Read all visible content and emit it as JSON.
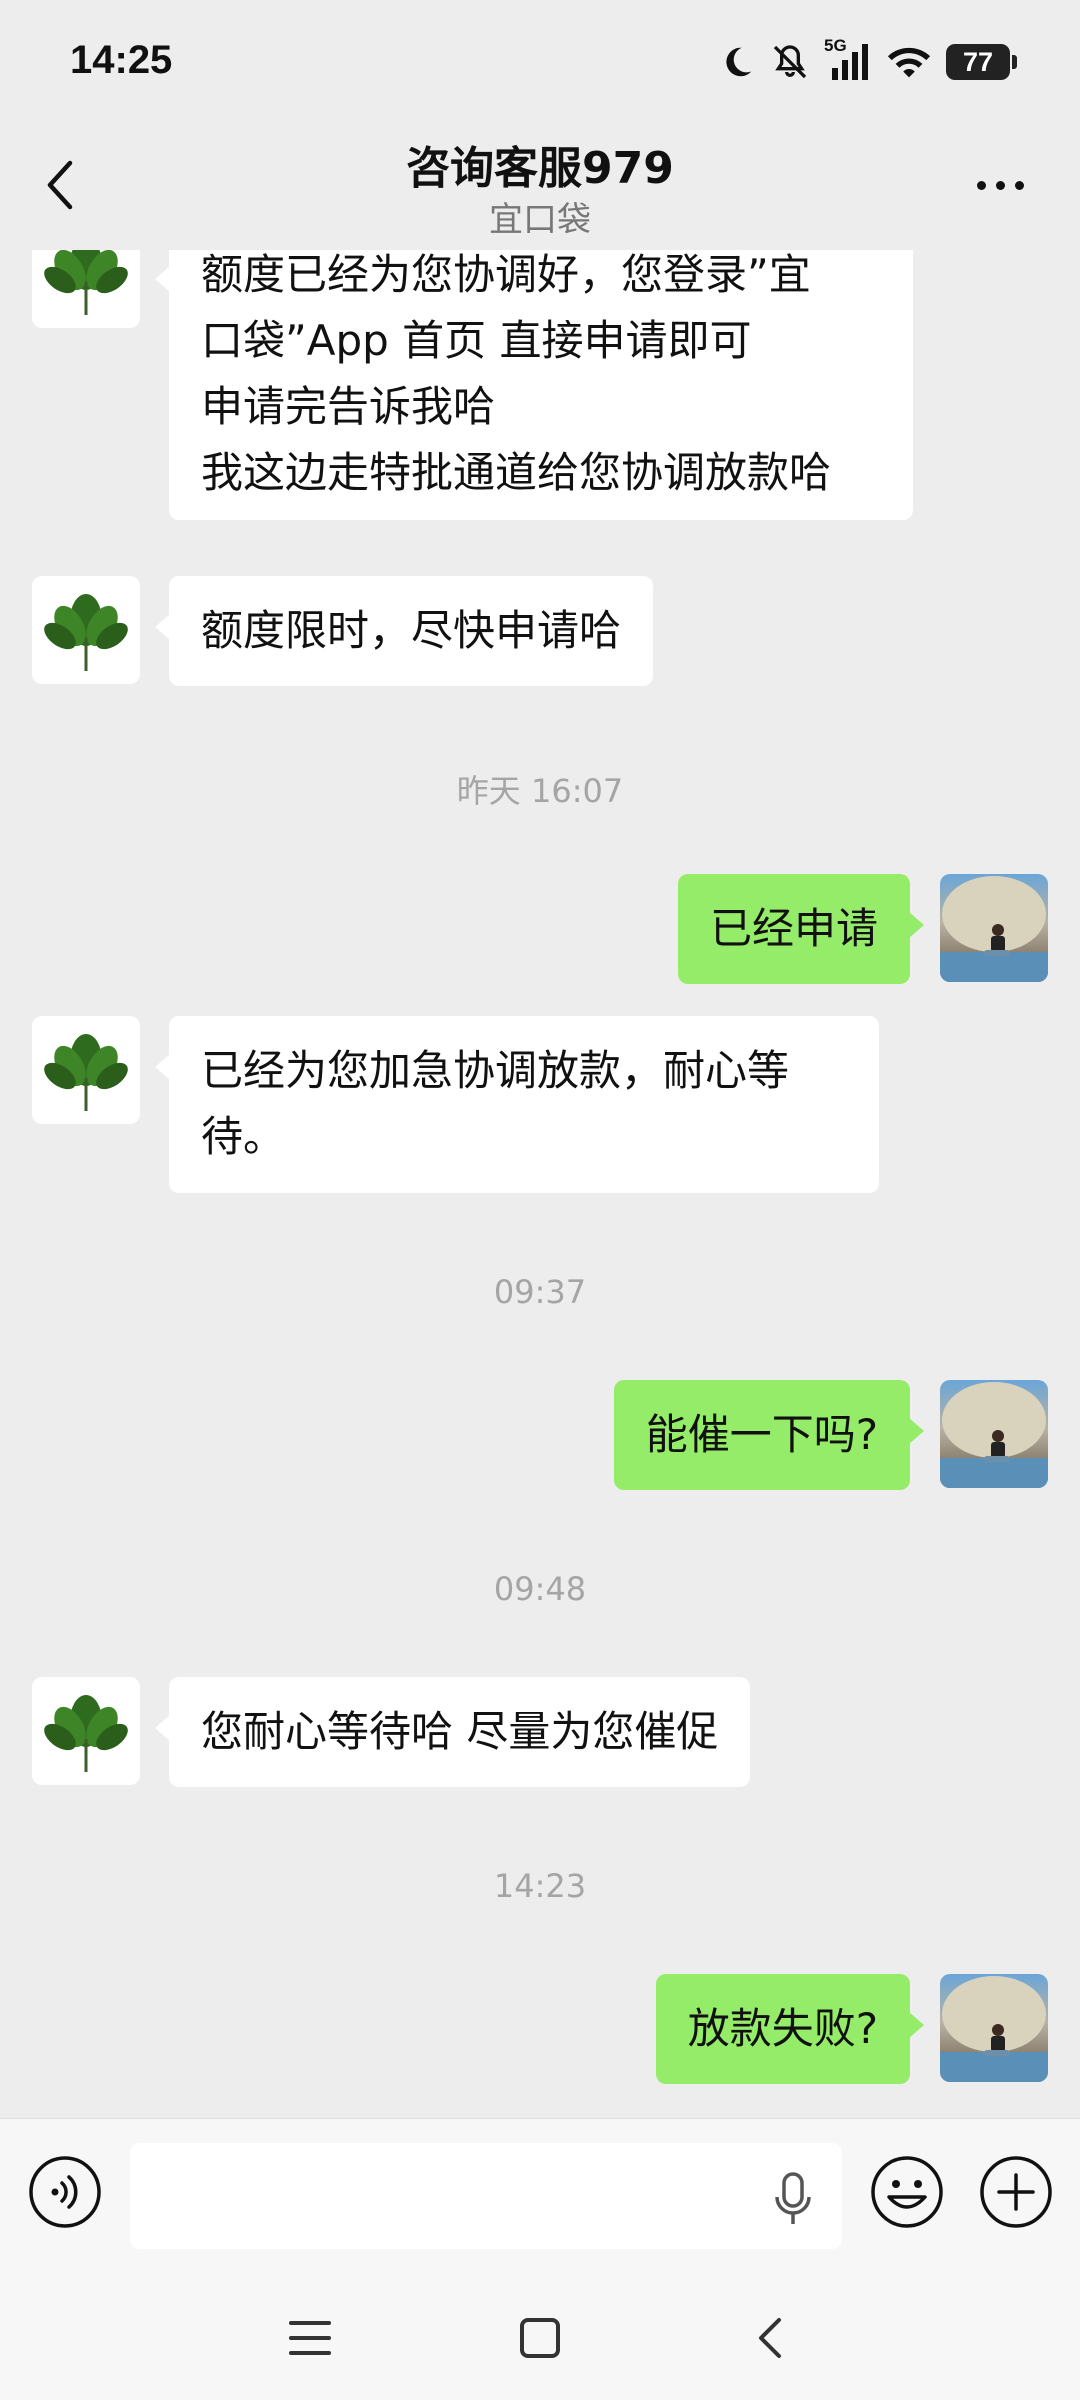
{
  "status_bar": {
    "time": "14:25",
    "network_label": "5G",
    "battery_level": "77",
    "icons": [
      "moon-icon",
      "mute-bell-icon",
      "signal-5g-icon",
      "wifi-icon",
      "battery-icon"
    ]
  },
  "header": {
    "title": "咨询客服979",
    "subtitle": "宜口袋",
    "back_icon": "chevron-left-icon",
    "more_icon": "more-dots-icon"
  },
  "messages": [
    {
      "sender": "agent",
      "lines": [
        "额度已经为您协调好，您登录”宜",
        "口袋”App 首页  直接申请即可",
        "申请完告诉我哈",
        "我这边走特批通道给您协调放款哈"
      ]
    },
    {
      "sender": "agent",
      "lines": [
        "额度限时，尽快申请哈"
      ]
    },
    {
      "type": "timestamp",
      "text": "昨天 16:07"
    },
    {
      "sender": "me",
      "lines": [
        "已经申请"
      ]
    },
    {
      "sender": "agent",
      "lines": [
        "已经为您加急协调放款，耐心等",
        "待。"
      ]
    },
    {
      "type": "timestamp",
      "text": "09:37"
    },
    {
      "sender": "me",
      "lines": [
        "能催一下吗?"
      ]
    },
    {
      "type": "timestamp",
      "text": "09:48"
    },
    {
      "sender": "agent",
      "lines": [
        "您耐心等待哈  尽量为您催促"
      ]
    },
    {
      "type": "timestamp",
      "text": "14:23"
    },
    {
      "sender": "me",
      "lines": [
        "放款失败?"
      ]
    }
  ],
  "input_bar": {
    "placeholder": "",
    "value": "",
    "icons": [
      "voice-icon",
      "microphone-icon",
      "emoji-icon",
      "plus-icon"
    ]
  },
  "nav_bar": {
    "icons": [
      "menu-icon",
      "home-square-icon",
      "back-chevron-icon"
    ]
  },
  "colors": {
    "background": "#ededed",
    "incoming_bubble": "#ffffff",
    "outgoing_bubble": "#95ec69",
    "timestamp_text": "#a5a5a5"
  }
}
